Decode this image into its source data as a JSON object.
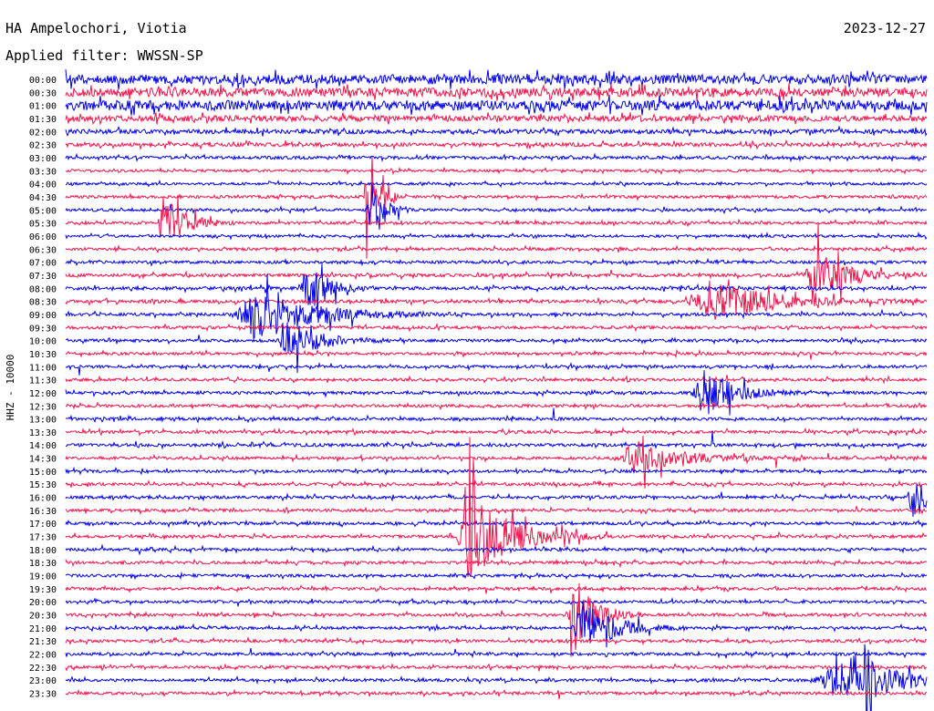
{
  "header": {
    "station": "HA Ampelochori, Viotia",
    "date": "2023-12-27",
    "filter": "Applied filter: WWSSN-SP"
  },
  "axis": {
    "ylabel": "HHZ - 10000"
  },
  "colors": {
    "trace_even": "#0000e6",
    "trace_odd": "#f0144b",
    "background": "#ffffff",
    "text": "#000000"
  },
  "chart_data": {
    "type": "line",
    "title": "HA Ampelochori, Viotia",
    "ylabel": "HHZ - 10000",
    "row_labels": [
      "00:00",
      "00:30",
      "01:00",
      "01:30",
      "02:00",
      "02:30",
      "03:00",
      "03:30",
      "04:00",
      "04:30",
      "05:00",
      "05:30",
      "06:00",
      "06:30",
      "07:00",
      "07:30",
      "08:00",
      "08:30",
      "09:00",
      "09:30",
      "10:00",
      "10:30",
      "11:00",
      "11:30",
      "12:00",
      "12:30",
      "13:00",
      "13:30",
      "14:00",
      "14:30",
      "15:00",
      "15:30",
      "16:00",
      "16:30",
      "17:00",
      "17:30",
      "18:00",
      "18:30",
      "19:00",
      "19:30",
      "20:00",
      "20:30",
      "21:00",
      "21:30",
      "22:00",
      "22:30",
      "23:00",
      "23:30"
    ],
    "row_duration_minutes": 30,
    "row_activity": [
      3.2,
      3.0,
      3.4,
      2.0,
      1.5,
      1.3,
      1.1,
      0.9,
      0.9,
      1.0,
      1.0,
      1.0,
      0.9,
      1.0,
      1.0,
      1.1,
      1.1,
      1.1,
      1.0,
      1.0,
      1.0,
      1.0,
      1.0,
      1.0,
      1.0,
      1.0,
      1.0,
      1.0,
      1.1,
      1.0,
      1.0,
      1.0,
      1.0,
      1.0,
      1.0,
      1.0,
      1.0,
      1.0,
      1.0,
      1.0,
      1.0,
      1.0,
      1.0,
      1.0,
      1.0,
      1.0,
      1.0,
      1.0
    ],
    "events": [
      {
        "row": 9,
        "time_fraction": 0.35,
        "amplitude": 4,
        "duration": 0.01
      },
      {
        "row": 10,
        "time_fraction": 0.355,
        "amplitude": 3,
        "duration": 0.012
      },
      {
        "row": 11,
        "time_fraction": 0.115,
        "amplitude": 2.2,
        "duration": 0.02
      },
      {
        "row": 15,
        "time_fraction": 0.87,
        "amplitude": 2,
        "duration": 0.03
      },
      {
        "row": 16,
        "time_fraction": 0.28,
        "amplitude": 2,
        "duration": 0.02
      },
      {
        "row": 17,
        "time_fraction": 0.75,
        "amplitude": 1.6,
        "duration": 0.06
      },
      {
        "row": 18,
        "time_fraction": 0.22,
        "amplitude": 1.8,
        "duration": 0.06
      },
      {
        "row": 20,
        "time_fraction": 0.26,
        "amplitude": 1.6,
        "duration": 0.03
      },
      {
        "row": 24,
        "time_fraction": 0.74,
        "amplitude": 2,
        "duration": 0.03
      },
      {
        "row": 29,
        "time_fraction": 0.66,
        "amplitude": 1.5,
        "duration": 0.04
      },
      {
        "row": 32,
        "time_fraction": 0.985,
        "amplitude": 1.6,
        "duration": 0.02
      },
      {
        "row": 35,
        "time_fraction": 0.47,
        "amplitude": 3.5,
        "duration": 0.04
      },
      {
        "row": 41,
        "time_fraction": 0.59,
        "amplitude": 3.5,
        "duration": 0.02
      },
      {
        "row": 42,
        "time_fraction": 0.6,
        "amplitude": 2.2,
        "duration": 0.03
      },
      {
        "row": 46,
        "time_fraction": 0.9,
        "amplitude": 1.4,
        "duration": 0.08
      },
      {
        "row": 46,
        "time_fraction": 0.93,
        "amplitude": 2.5,
        "duration": 0.005
      }
    ]
  }
}
